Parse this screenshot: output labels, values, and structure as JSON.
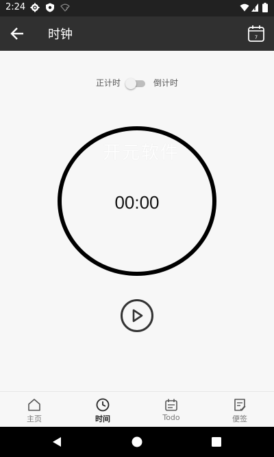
{
  "status_bar": {
    "time": "2:24",
    "icons": [
      "gear-icon",
      "shield-icon",
      "wifi-question-icon"
    ],
    "right_icons": [
      "wifi-icon",
      "signal-icon",
      "battery-icon"
    ]
  },
  "app_bar": {
    "title": "时钟",
    "back_icon": "arrow-left-icon",
    "calendar_icon": "calendar-icon",
    "calendar_day": "7"
  },
  "mode_toggle": {
    "left_label": "正计时",
    "right_label": "倒计时",
    "checked": false
  },
  "watermark": "开元软件",
  "timer": {
    "display": "00:00"
  },
  "play_button": {
    "icon": "play-icon"
  },
  "bottom_nav": {
    "items": [
      {
        "label": "主页",
        "icon": "home-icon",
        "active": false
      },
      {
        "label": "时间",
        "icon": "clock-icon",
        "active": true
      },
      {
        "label": "Todo",
        "icon": "todo-calendar-icon",
        "active": false
      },
      {
        "label": "便签",
        "icon": "note-icon",
        "active": false
      }
    ]
  },
  "system_nav": {
    "back": "back-triangle-icon",
    "home": "home-circle-icon",
    "recents": "recents-square-icon"
  },
  "colors": {
    "status_bar": "#212121",
    "app_bar": "#303030",
    "background": "#f7f7f7",
    "ring": "#000000"
  }
}
